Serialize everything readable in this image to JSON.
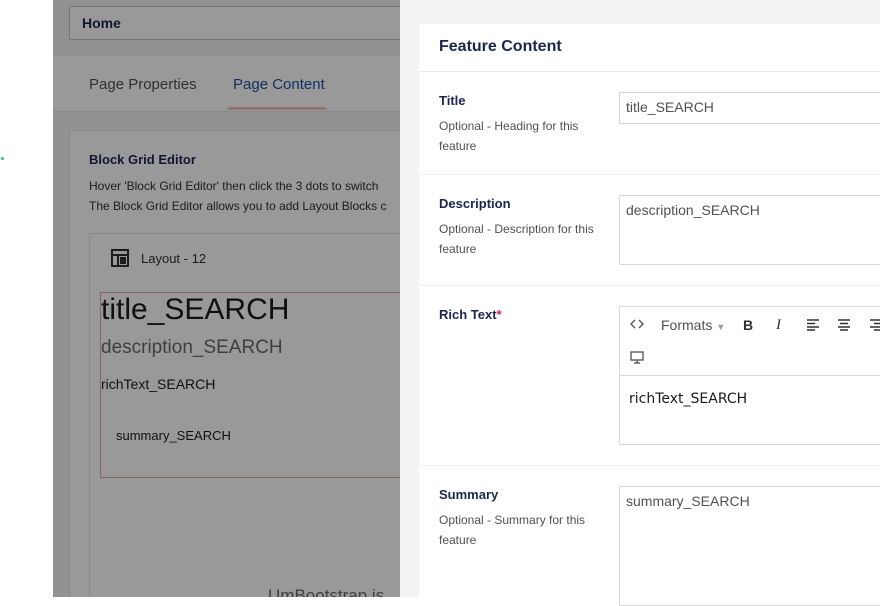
{
  "page": {
    "name_value": "Home",
    "tabs": [
      {
        "label": "Page Properties"
      },
      {
        "label": "Page Content"
      }
    ],
    "block_grid": {
      "title": "Block Grid Editor",
      "desc_line1": "Hover 'Block Grid Editor' then click the 3 dots to switch",
      "desc_line2": "The Block Grid Editor allows you to add Layout Blocks c",
      "layout_label": "Layout - 12",
      "preview": {
        "title": "title_SEARCH",
        "description": "description_SEARCH",
        "rich_text": "richText_SEARCH",
        "summary": "summary_SEARCH"
      },
      "footer_text": "UmBootstrap is"
    }
  },
  "panel": {
    "title": "Feature Content",
    "fields": {
      "title": {
        "label": "Title",
        "desc": "Optional - Heading for this feature",
        "value": "title_SEARCH"
      },
      "description": {
        "label": "Description",
        "desc": "Optional - Description for this feature",
        "value": "description_SEARCH"
      },
      "rich_text": {
        "label": "Rich Text",
        "required_mark": "*",
        "toolbar": {
          "source_icon": "code-icon",
          "formats_label": "Formats",
          "bold": "B",
          "italic": "I",
          "align_left_icon": "align-left-icon",
          "align_center_icon": "align-center-icon",
          "align_right_icon": "align-right-icon",
          "embed_icon": "embed-icon"
        },
        "value": "richText_SEARCH"
      },
      "summary": {
        "label": "Summary",
        "desc": "Optional - Summary for this feature",
        "value": "summary_SEARCH"
      }
    }
  },
  "colors": {
    "accent": "#2152a3",
    "tab_indicator": "#f5c1bc",
    "required": "#d42054",
    "preview_border": "#e8a8a1",
    "navy_text": "#1b264f",
    "status_dot": "#2bc37c"
  }
}
